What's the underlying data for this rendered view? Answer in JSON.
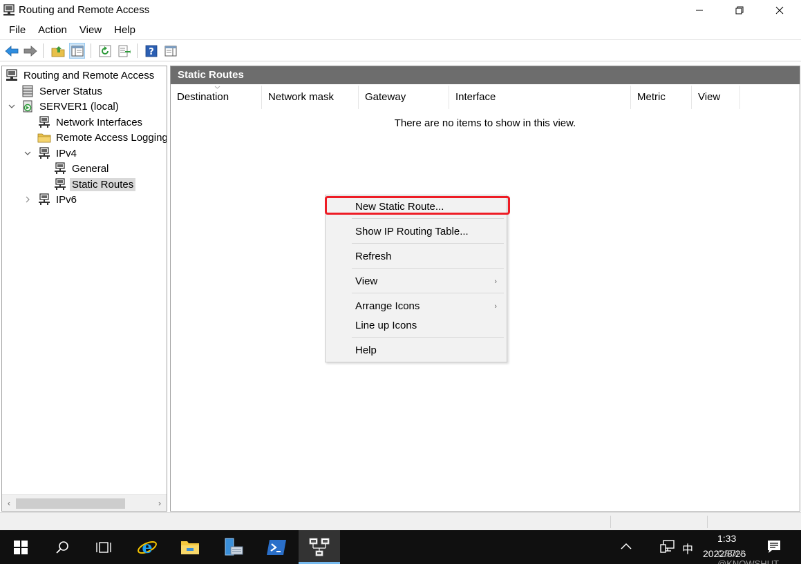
{
  "window": {
    "title": "Routing and Remote Access"
  },
  "menu": [
    "File",
    "Action",
    "View",
    "Help"
  ],
  "tree": {
    "items": [
      {
        "label": "Routing and Remote Access",
        "icon": "computer-icon"
      },
      {
        "label": "Server Status",
        "icon": "server-status-icon"
      },
      {
        "label": "SERVER1 (local)",
        "icon": "server-icon"
      },
      {
        "label": "Network Interfaces",
        "icon": "network-icon"
      },
      {
        "label": "Remote Access Logging &",
        "icon": "folder-icon"
      },
      {
        "label": "IPv4",
        "icon": "network-icon"
      },
      {
        "label": "General",
        "icon": "network-icon"
      },
      {
        "label": "Static Routes",
        "icon": "network-icon"
      },
      {
        "label": "IPv6",
        "icon": "network-icon"
      }
    ]
  },
  "content": {
    "header": "Static Routes",
    "columns": [
      "Destination",
      "Network mask",
      "Gateway",
      "Interface",
      "Metric",
      "View"
    ],
    "empty_message": "There are no items to show in this view."
  },
  "context_menu": {
    "items": [
      {
        "label": "New Static Route..."
      },
      {
        "label": "Show IP Routing Table..."
      },
      {
        "label": "Refresh"
      },
      {
        "label": "View"
      },
      {
        "label": "Arrange Icons"
      },
      {
        "label": "Line up Icons"
      },
      {
        "label": "Help"
      }
    ]
  },
  "taskbar": {
    "time": "1:33",
    "date": "2022/8/26",
    "ime": "中",
    "watermark": "CSDN @KNOWSHUT"
  },
  "colors": {
    "header_bg": "#6d6d6d",
    "highlight": "#ee1c25",
    "taskbar_bg": "#101010",
    "accent": "#76b9ed"
  }
}
